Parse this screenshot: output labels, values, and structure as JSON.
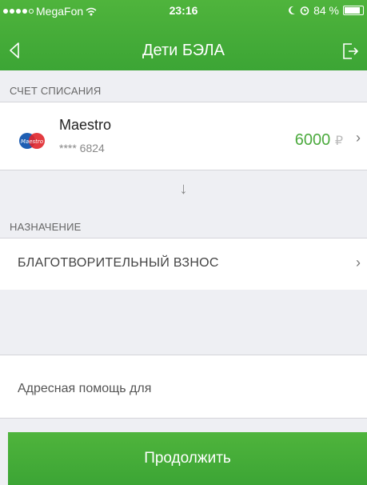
{
  "status_bar": {
    "carrier": "MegaFon",
    "time": "23:16",
    "battery": "84 %"
  },
  "nav": {
    "title": "Дети БЭЛА"
  },
  "debit_section": {
    "label": "СЧЕТ СПИСАНИЯ",
    "card": {
      "name": "Maestro",
      "number": "**** 6824",
      "amount": "6000",
      "currency": "₽"
    }
  },
  "purpose_section": {
    "label": "НАЗНАЧЕНИЕ",
    "value": "БЛАГОТВОРИТЕЛЬНЫЙ ВЗНОС"
  },
  "comment": {
    "value": "Адресная помощь для"
  },
  "submit": {
    "label": "Продолжить"
  },
  "colors": {
    "brand_green": "#3ca535",
    "amount_green": "#4caa3e"
  }
}
